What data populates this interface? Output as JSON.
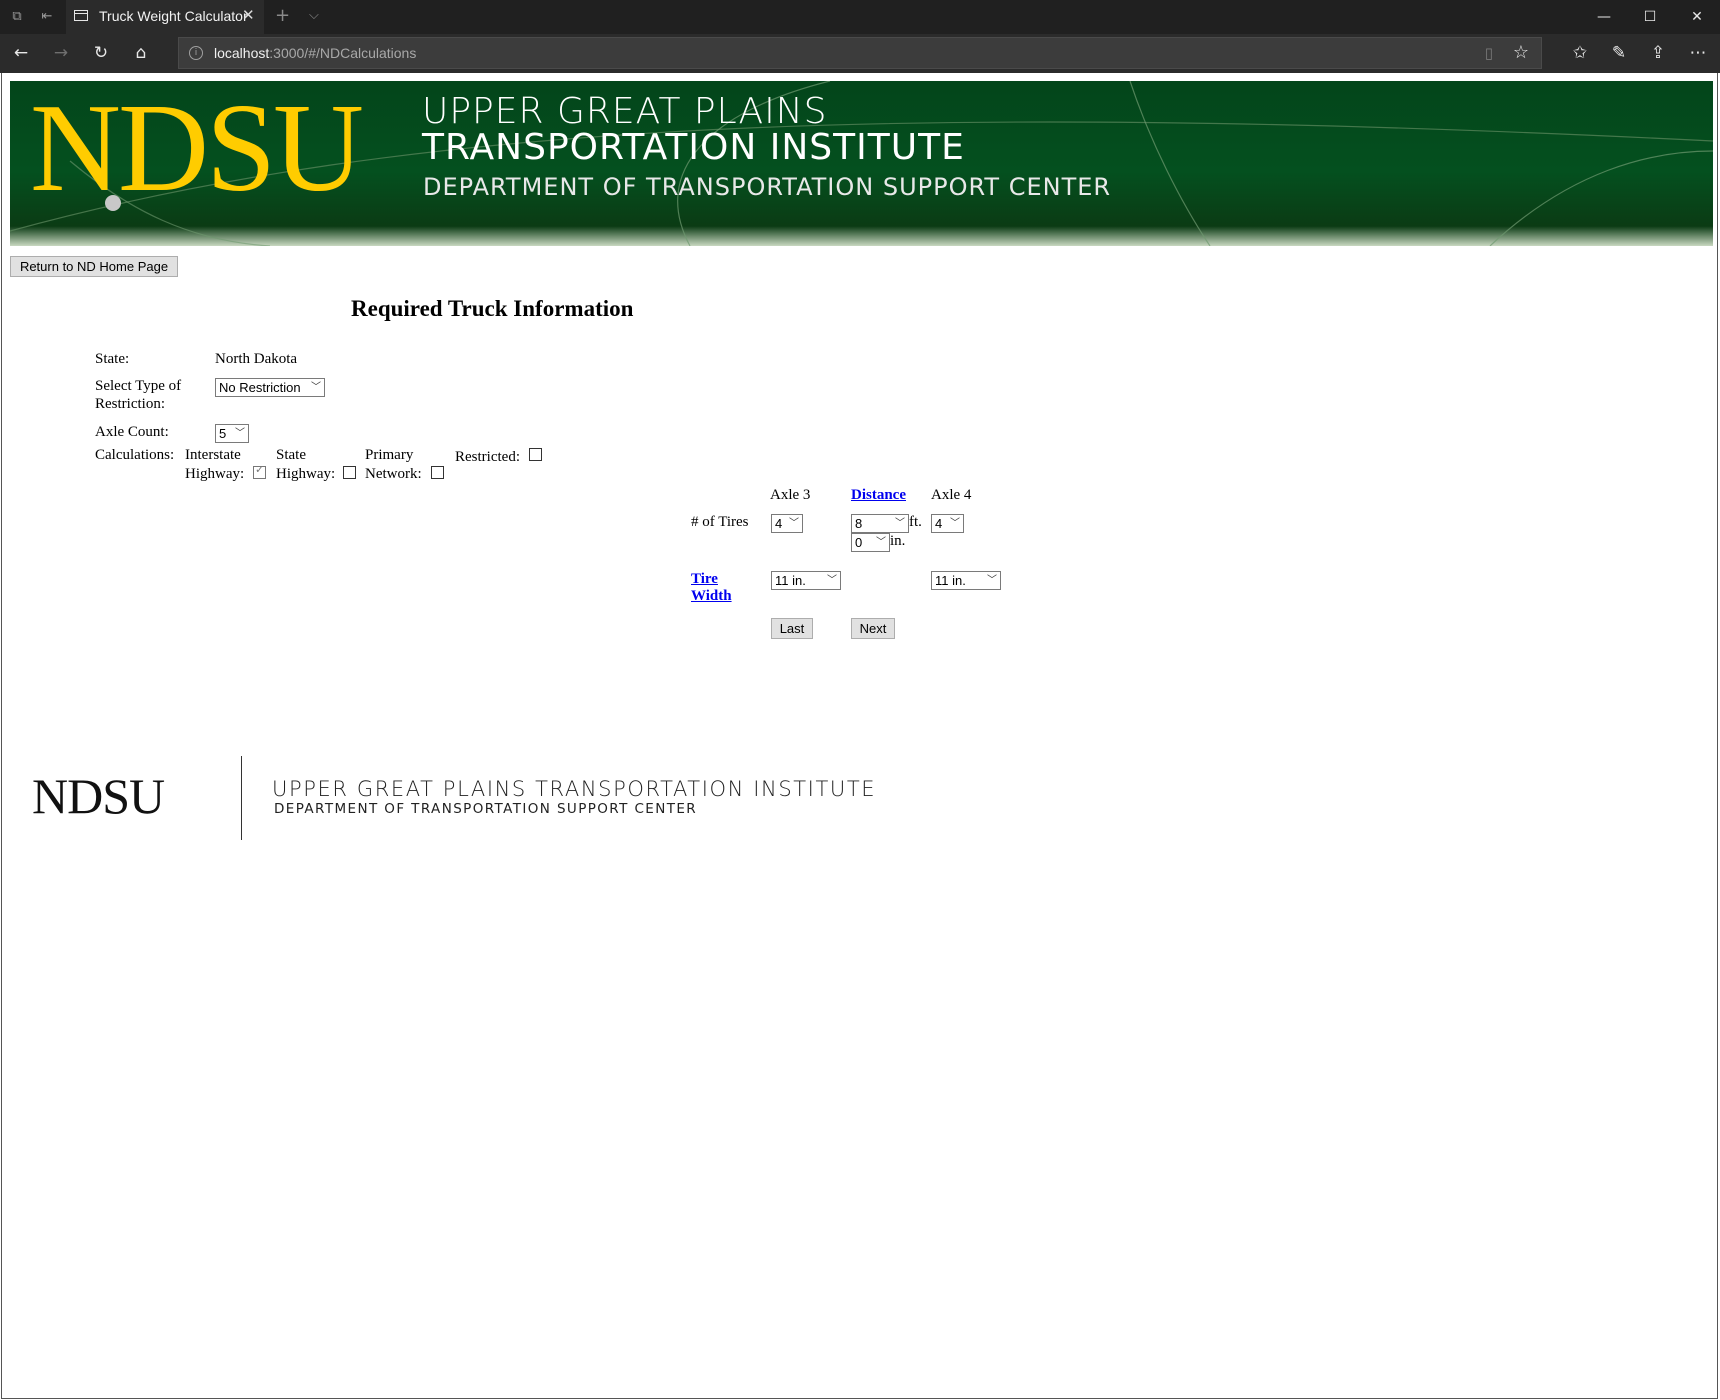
{
  "browser": {
    "tab_title": "Truck Weight Calculator",
    "url_host": "localhost",
    "url_path": ":3000/#/NDCalculations"
  },
  "banner": {
    "logo_text": "NDSU",
    "line1": "UPPER GREAT PLAINS",
    "line2": "TRANSPORTATION INSTITUTE",
    "line3": "DEPARTMENT OF TRANSPORTATION SUPPORT CENTER"
  },
  "return_button": "Return to ND Home Page",
  "heading": "Required Truck Information",
  "form": {
    "state_label": "State:",
    "state_value": "North Dakota",
    "restriction_label_1": "Select Type of",
    "restriction_label_2": "Restriction:",
    "restriction_value": "No Restriction",
    "axle_count_label": "Axle Count:",
    "axle_count_value": "5",
    "calculations_label": "Calculations:",
    "calc_options": [
      {
        "line1": "Interstate",
        "line2": "Highway:",
        "checked": true
      },
      {
        "line1": "State",
        "line2": "Highway:",
        "checked": false
      },
      {
        "line1": "Primary",
        "line2": "Network:",
        "checked": false
      },
      {
        "line1": "Restricted:",
        "line2": "",
        "checked": false
      }
    ]
  },
  "axle_table": {
    "col_axle_a": "Axle 3",
    "col_distance": "Distance",
    "col_axle_b": "Axle 4",
    "tires_label": "# of Tires",
    "tires_a": "4",
    "tires_b": "4",
    "distance_ft": "8",
    "distance_ft_unit": "ft.",
    "distance_in": "0",
    "distance_in_unit": "in.",
    "tire_width_label_1": "Tire",
    "tire_width_label_2": "Width",
    "width_a": "11 in.",
    "width_b": "11 in.",
    "last_button": "Last",
    "next_button": "Next"
  },
  "footer": {
    "logo_text": "NDSU",
    "line1": "UPPER GREAT PLAINS TRANSPORTATION INSTITUTE",
    "line2": "DEPARTMENT OF TRANSPORTATION SUPPORT CENTER"
  },
  "colors": {
    "banner_green": "#04501f",
    "ndsu_yellow": "#ffcc00",
    "link_blue": "#0000ee"
  }
}
